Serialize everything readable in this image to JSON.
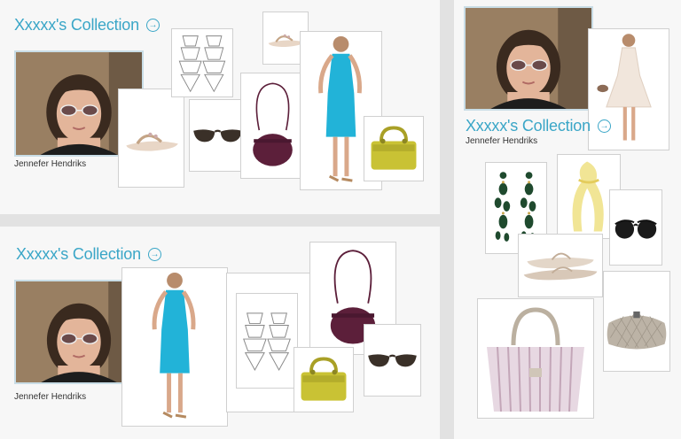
{
  "collections": [
    {
      "title": "Xxxxx's Collection",
      "owner": "Jennefer Hendriks"
    },
    {
      "title": "Xxxxx's Collection",
      "owner": "Jennefer Hendriks"
    },
    {
      "title": "Xxxxx's Collection",
      "owner": "Jennefer Hendriks"
    }
  ],
  "icons": {
    "open": "arrow-circle-right-icon",
    "arrow_glyph": "→"
  },
  "colors": {
    "accent": "#3aa6c7",
    "dress_blue": "#22b3d8",
    "bag_purple": "#5c1f3a",
    "bag_yellow": "#c9c234",
    "background": "#e2e2e2",
    "panel": "#f7f7f7"
  }
}
